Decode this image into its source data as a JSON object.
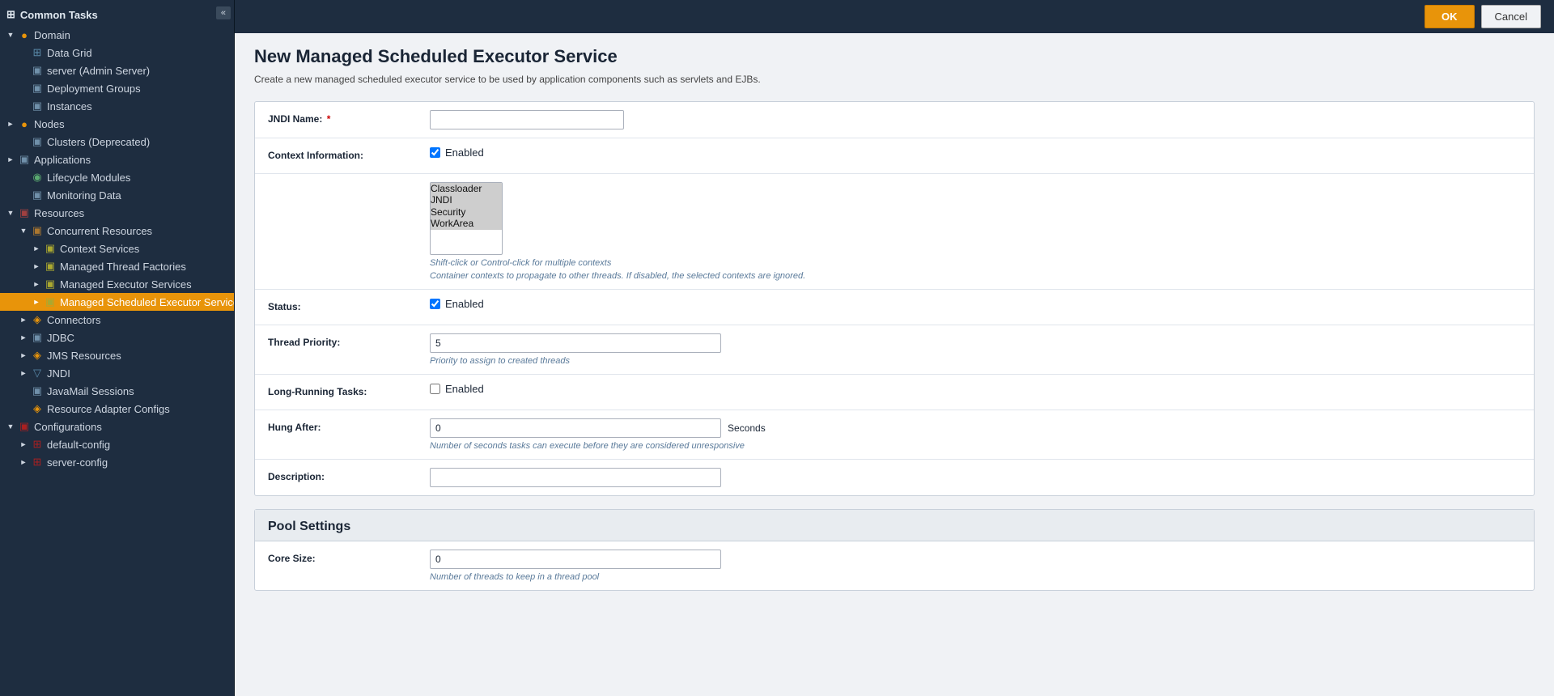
{
  "sidebar": {
    "common_tasks_label": "Common Tasks",
    "toggle_label": "«",
    "items": [
      {
        "id": "domain",
        "label": "Domain",
        "level": 0,
        "expanded": true,
        "icon": "▼",
        "type": "domain"
      },
      {
        "id": "data-grid",
        "label": "Data Grid",
        "level": 1,
        "icon": "⊞",
        "type": "grid"
      },
      {
        "id": "admin-server",
        "label": "server (Admin Server)",
        "level": 1,
        "icon": "▣",
        "type": "server"
      },
      {
        "id": "deployment-groups",
        "label": "Deployment Groups",
        "level": 1,
        "icon": "▣",
        "type": "deploy"
      },
      {
        "id": "instances",
        "label": "Instances",
        "level": 1,
        "icon": "▣",
        "type": "instances"
      },
      {
        "id": "nodes",
        "label": "Nodes",
        "level": 0,
        "icon": "►",
        "type": "nodes",
        "hasArrow": true
      },
      {
        "id": "clusters",
        "label": "Clusters (Deprecated)",
        "level": 1,
        "icon": "▣",
        "type": "cluster"
      },
      {
        "id": "applications",
        "label": "Applications",
        "level": 0,
        "icon": "►",
        "type": "apps",
        "hasArrow": true
      },
      {
        "id": "lifecycle",
        "label": "Lifecycle Modules",
        "level": 1,
        "icon": "◉",
        "type": "lifecycle"
      },
      {
        "id": "monitoring",
        "label": "Monitoring Data",
        "level": 1,
        "icon": "▣",
        "type": "monitor"
      },
      {
        "id": "resources",
        "label": "Resources",
        "level": 0,
        "icon": "▼",
        "type": "resources",
        "expanded": true
      },
      {
        "id": "concurrent",
        "label": "Concurrent Resources",
        "level": 1,
        "icon": "▼",
        "type": "concurrent",
        "expanded": true
      },
      {
        "id": "context-services",
        "label": "Context Services",
        "level": 2,
        "icon": "►",
        "type": "folder"
      },
      {
        "id": "thread-factories",
        "label": "Managed Thread Factories",
        "level": 2,
        "icon": "►",
        "type": "folder"
      },
      {
        "id": "executor-services",
        "label": "Managed Executor Services",
        "level": 2,
        "icon": "►",
        "type": "folder"
      },
      {
        "id": "scheduled-executor",
        "label": "Managed Scheduled Executor Services",
        "level": 2,
        "icon": "►",
        "type": "folder",
        "active": true
      },
      {
        "id": "connectors",
        "label": "Connectors",
        "level": 1,
        "icon": "►",
        "type": "connector",
        "hasArrow": true
      },
      {
        "id": "jdbc",
        "label": "JDBC",
        "level": 1,
        "icon": "►",
        "type": "jdbc",
        "hasArrow": true
      },
      {
        "id": "jms",
        "label": "JMS Resources",
        "level": 1,
        "icon": "►",
        "type": "jms",
        "hasArrow": true
      },
      {
        "id": "jndi",
        "label": "JNDI",
        "level": 1,
        "icon": "►",
        "type": "jndi",
        "hasArrow": true
      },
      {
        "id": "javamail",
        "label": "JavaMail Sessions",
        "level": 1,
        "icon": "▣",
        "type": "mail"
      },
      {
        "id": "resource-adapter",
        "label": "Resource Adapter Configs",
        "level": 1,
        "icon": "◈",
        "type": "adapter"
      },
      {
        "id": "configurations",
        "label": "Configurations",
        "level": 0,
        "icon": "▼",
        "type": "config",
        "expanded": true
      },
      {
        "id": "default-config",
        "label": "default-config",
        "level": 1,
        "icon": "►",
        "type": "config-item",
        "hasArrow": true
      },
      {
        "id": "server-config",
        "label": "server-config",
        "level": 1,
        "icon": "►",
        "type": "config-item",
        "hasArrow": true
      }
    ]
  },
  "topbar": {
    "ok_label": "OK",
    "cancel_label": "Cancel"
  },
  "page": {
    "title": "New Managed Scheduled Executor Service",
    "description": "Create a new managed scheduled executor service to be used by application components such as servlets and EJBs."
  },
  "form": {
    "jndi_name_label": "JNDI Name:",
    "jndi_name_value": "",
    "context_info_label": "Context Information:",
    "context_enabled_label": "Enabled",
    "context_list": [
      "Classloader",
      "JNDI",
      "Security",
      "WorkArea"
    ],
    "context_hint1": "Shift-click or Control-click for multiple contexts",
    "context_hint2": "Container contexts to propagate to other threads. If disabled, the selected contexts are ignored.",
    "status_label": "Status:",
    "status_enabled_label": "Enabled",
    "thread_priority_label": "Thread Priority:",
    "thread_priority_value": "5",
    "thread_priority_hint": "Priority to assign to created threads",
    "long_running_label": "Long-Running Tasks:",
    "long_running_enabled_label": "Enabled",
    "hung_after_label": "Hung After:",
    "hung_after_value": "0",
    "hung_after_unit": "Seconds",
    "hung_after_hint": "Number of seconds tasks can execute before they are considered unresponsive",
    "description_label": "Description:",
    "description_value": "",
    "pool_settings_title": "Pool Settings",
    "core_size_label": "Core Size:",
    "core_size_value": "0",
    "core_size_hint": "Number of threads to keep in a thread pool"
  }
}
